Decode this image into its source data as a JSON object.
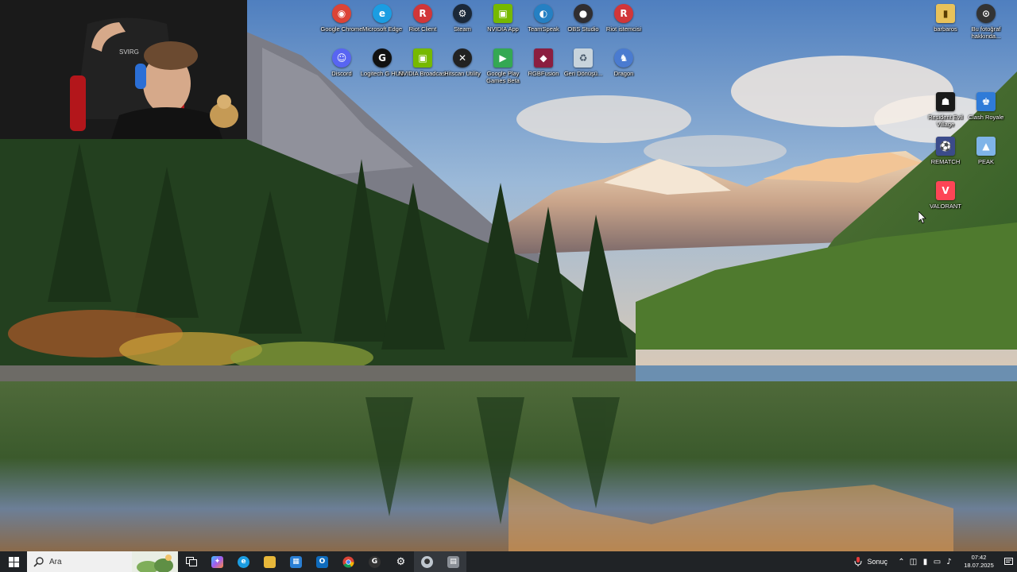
{
  "desktop": {
    "icons": [
      {
        "label": "Google Chrome",
        "icon": "chrome-icon",
        "color": "#db4437"
      },
      {
        "label": "Microsoft Edge",
        "icon": "edge-icon",
        "color": "#1b9de2"
      },
      {
        "label": "Riot Client",
        "icon": "riot-client-icon",
        "color": "#d13639"
      },
      {
        "label": "Steam",
        "icon": "steam-icon",
        "color": "#1b2838"
      },
      {
        "label": "NVIDIA App",
        "icon": "nvidia-app-icon",
        "color": "#76b900"
      },
      {
        "label": "TeamSpeak",
        "icon": "teamspeak-icon",
        "color": "#2580c3"
      },
      {
        "label": "OBS Studio",
        "icon": "obs-icon",
        "color": "#302e31"
      },
      {
        "label": "Riot istemcisi",
        "icon": "riot-istemcisi-icon",
        "color": "#d13639"
      },
      {
        "label": "Discord",
        "icon": "discord-icon",
        "color": "#5865f2"
      },
      {
        "label": "Logitech G HUB",
        "icon": "logitech-ghub-icon",
        "color": "#111111"
      },
      {
        "label": "NVIDIA Broadcast",
        "icon": "nvidia-broadcast-icon",
        "color": "#76b900"
      },
      {
        "label": "Hitscan Utility",
        "icon": "hitscan-icon",
        "color": "#222222"
      },
      {
        "label": "Google Play Games Beta",
        "icon": "google-play-games-icon",
        "color": "#34a853"
      },
      {
        "label": "RGBFusion",
        "icon": "rgbfusion-icon",
        "color": "#8b1e3f"
      },
      {
        "label": "Geri Dönüşü...",
        "icon": "recycle-bin-icon",
        "color": "#c8d4dc"
      },
      {
        "label": "Dragon",
        "icon": "dragon-icon",
        "color": "#4a7bd0"
      },
      {
        "label": "barbaros",
        "icon": "user-folder-icon",
        "color": "#e8c25a"
      },
      {
        "label": "Bu fotoğraf hakkında...",
        "icon": "photo-info-icon",
        "color": "#333333"
      },
      {
        "label": "Resident Evil Village",
        "icon": "resident-evil-icon",
        "color": "#1a1a1a"
      },
      {
        "label": "Clash Royale",
        "icon": "clash-royale-icon",
        "color": "#2f7bd8"
      },
      {
        "label": "REMATCH",
        "icon": "rematch-icon",
        "color": "#3b4b8a"
      },
      {
        "label": "PEAK",
        "icon": "peak-icon",
        "color": "#7fb4e8"
      },
      {
        "label": "VALORANT",
        "icon": "valorant-icon",
        "color": "#fd4556"
      }
    ]
  },
  "taskbar": {
    "search_placeholder": "Ara",
    "weather_text": "Sonuç",
    "time": "07:42",
    "date": "18.07.2025",
    "apps": [
      {
        "name": "task-view-icon",
        "glyph": "▭",
        "color": "#202326"
      },
      {
        "name": "copilot-icon",
        "glyph": "✦",
        "color": "#7b5cf0"
      },
      {
        "name": "edge-icon",
        "glyph": "e",
        "color": "#1b9de2"
      },
      {
        "name": "file-explorer-icon",
        "glyph": "▬",
        "color": "#e8b83a"
      },
      {
        "name": "microsoft-store-icon",
        "glyph": "▦",
        "color": "#2a7fd4"
      },
      {
        "name": "outlook-icon",
        "glyph": "O",
        "color": "#0f6cbd"
      },
      {
        "name": "chrome-icon",
        "glyph": "◉",
        "color": "#db4437"
      },
      {
        "name": "ghub-icon",
        "glyph": "G",
        "color": "#333333"
      },
      {
        "name": "settings-icon",
        "glyph": "⚙",
        "color": "#202326"
      },
      {
        "name": "obs-icon",
        "glyph": "●",
        "color": "#3a3a3a"
      },
      {
        "name": "app-window-icon",
        "glyph": "▤",
        "color": "#555555"
      }
    ]
  }
}
